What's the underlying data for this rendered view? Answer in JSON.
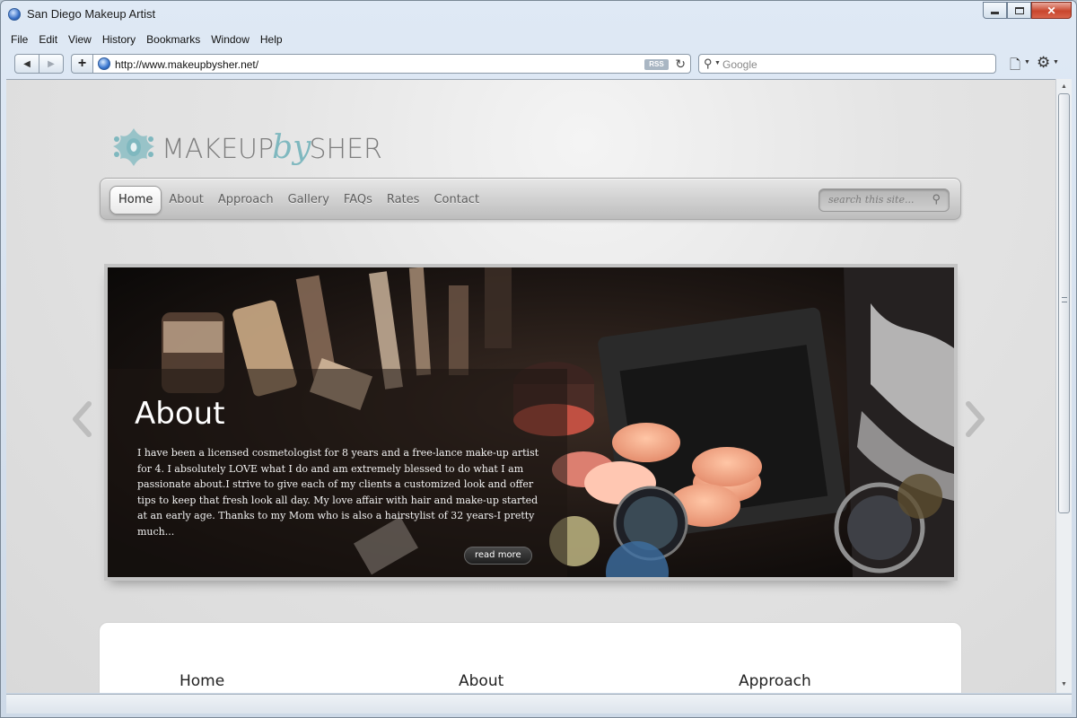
{
  "window": {
    "title": "San Diego Makeup Artist"
  },
  "menu": [
    "File",
    "Edit",
    "View",
    "History",
    "Bookmarks",
    "Window",
    "Help"
  ],
  "toolbar": {
    "back": "◀",
    "forward": "▶",
    "add": "+",
    "url": "http://www.makeupbysher.net/",
    "rss": "RSS",
    "search_placeholder": "Google"
  },
  "site": {
    "logo": {
      "make": "MAKEUP",
      "by": "by",
      "sher": "SHER"
    },
    "nav": [
      "Home",
      "About",
      "Approach",
      "Gallery",
      "FAQs",
      "Rates",
      "Contact"
    ],
    "active_nav": "Home",
    "search_placeholder": "search this site...",
    "slide": {
      "title": "About",
      "text": "I have been a licensed cosmetologist for 8 years and a free-lance make-up artist for 4. I absolutely LOVE what I do and am extremely blessed to do what I am passionate about.I strive to give each of my clients a customized look and offer tips to keep that fresh look all day. My love affair with hair and make-up started at an early age.  Thanks to my Mom who is also a hairstylist of 32 years-I pretty much...",
      "read_more": "read more"
    },
    "columns": [
      "Home",
      "About",
      "Approach"
    ]
  },
  "colors": {
    "accent": "#7fb8bf",
    "nav_text": "#5d5d5d",
    "close_button": "#c9462d"
  }
}
